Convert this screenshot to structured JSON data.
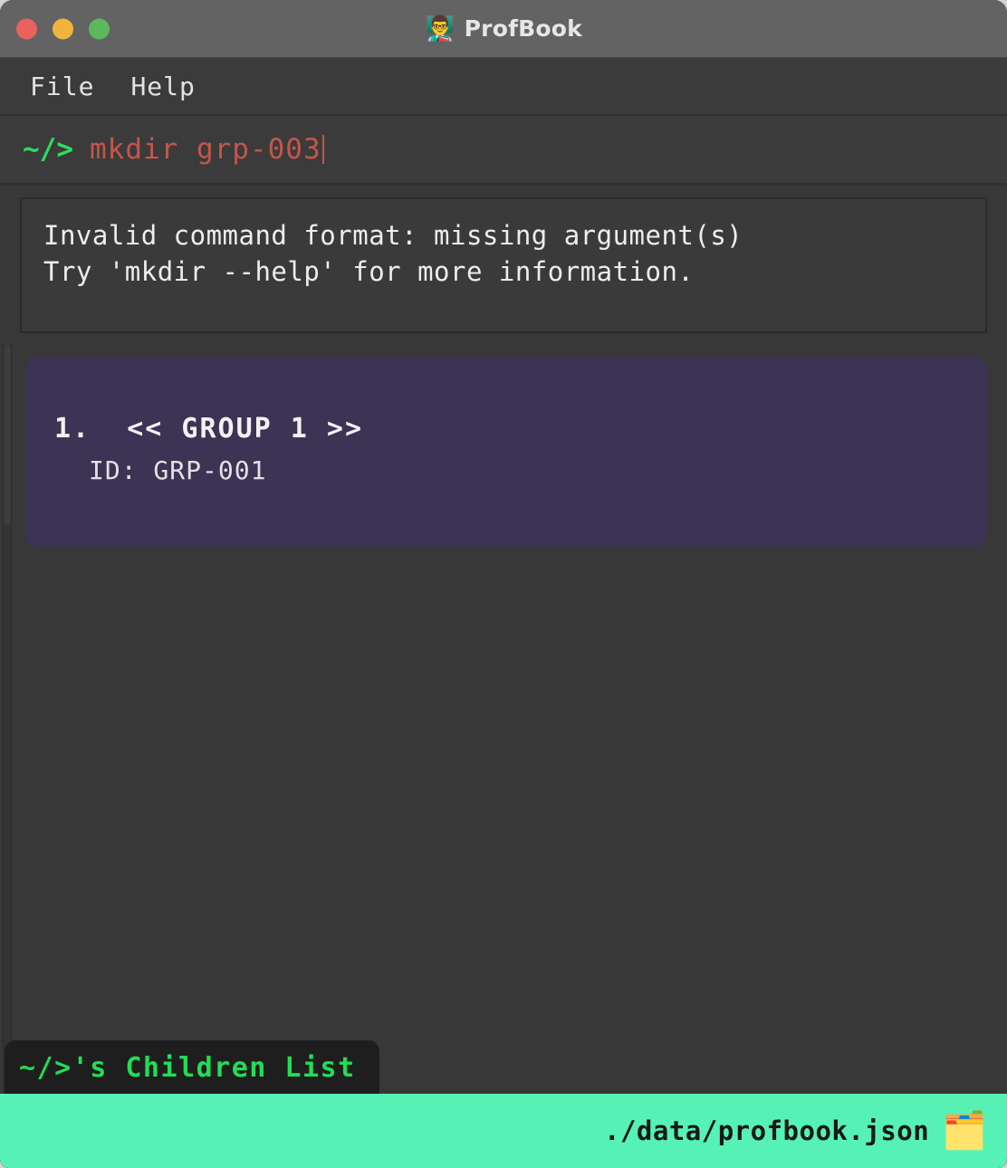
{
  "window": {
    "title": "ProfBook",
    "title_icon": "teacher-icon",
    "title_icon_glyph": "👨‍🏫",
    "traffic_lights": [
      {
        "name": "close",
        "color": "#e8635d"
      },
      {
        "name": "minimize",
        "color": "#f0b43c"
      },
      {
        "name": "maximize",
        "color": "#5cb85c"
      }
    ]
  },
  "menubar": {
    "items": [
      {
        "label": "File"
      },
      {
        "label": "Help"
      }
    ]
  },
  "command_line": {
    "prompt": "~/>",
    "prompt_color": "#2ddd5e",
    "value": "mkdir grp-003",
    "text_color": "#c4564a",
    "cursor_visible": true
  },
  "result_panel": {
    "lines": [
      "Invalid command format: missing argument(s)",
      "Try 'mkdir --help' for more information."
    ],
    "text_color": "#ededed",
    "border_color": "#2b2b2b"
  },
  "list_area": {
    "card_color": "#3c3355",
    "items": [
      {
        "index": "1.",
        "title": "<< GROUP 1 >>",
        "id_label": "ID: GRP-001"
      }
    ]
  },
  "bottom": {
    "tab_label": "~/>'s Children List",
    "tab_text_color": "#22dd55",
    "tab_bg_color": "#1e1e1e",
    "status_path": "./data/profbook.json",
    "status_bg_color": "#56f2b5",
    "status_icon": "card-index-dividers-icon",
    "status_icon_glyph": "🗂️"
  }
}
